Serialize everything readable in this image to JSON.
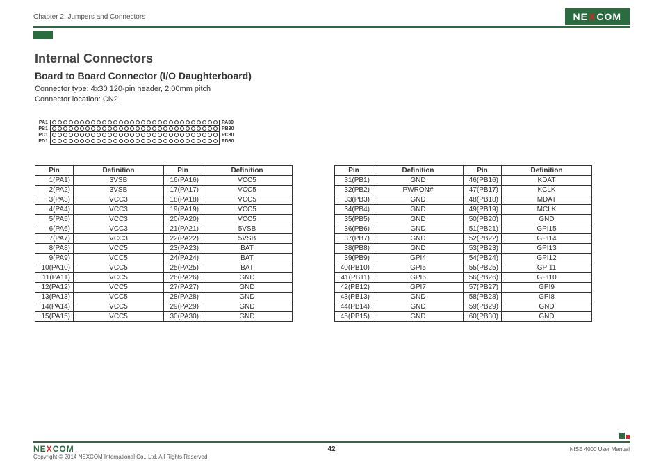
{
  "header": {
    "chapter": "Chapter 2: Jumpers and Connectors",
    "brand_pre": "NE",
    "brand_x": "X",
    "brand_post": "COM"
  },
  "title": "Internal Connectors",
  "subtitle": "Board to Board Connector (I/O Daughterboard)",
  "desc_line1": "Connector type: 4x30 120-pin header, 2.00mm pitch",
  "desc_line2": "Connector location: CN2",
  "diagram": {
    "rows": [
      {
        "left": "PA1",
        "right": "PA30"
      },
      {
        "left": "PB1",
        "right": "PB30"
      },
      {
        "left": "PC1",
        "right": "PC30"
      },
      {
        "left": "PD1",
        "right": "PD30"
      }
    ],
    "pins_per_row": 30
  },
  "table_headers": {
    "pin": "Pin",
    "def": "Definition"
  },
  "table1": [
    {
      "p1": "1(PA1)",
      "d1": "3VSB",
      "p2": "16(PA16)",
      "d2": "VCC5"
    },
    {
      "p1": "2(PA2)",
      "d1": "3VSB",
      "p2": "17(PA17)",
      "d2": "VCC5"
    },
    {
      "p1": "3(PA3)",
      "d1": "VCC3",
      "p2": "18(PA18)",
      "d2": "VCC5"
    },
    {
      "p1": "4(PA4)",
      "d1": "VCC3",
      "p2": "19(PA19)",
      "d2": "VCC5"
    },
    {
      "p1": "5(PA5)",
      "d1": "VCC3",
      "p2": "20(PA20)",
      "d2": "VCC5"
    },
    {
      "p1": "6(PA6)",
      "d1": "VCC3",
      "p2": "21(PA21)",
      "d2": "5VSB"
    },
    {
      "p1": "7(PA7)",
      "d1": "VCC3",
      "p2": "22(PA22)",
      "d2": "5VSB"
    },
    {
      "p1": "8(PA8)",
      "d1": "VCC5",
      "p2": "23(PA23)",
      "d2": "BAT"
    },
    {
      "p1": "9(PA9)",
      "d1": "VCC5",
      "p2": "24(PA24)",
      "d2": "BAT"
    },
    {
      "p1": "10(PA10)",
      "d1": "VCC5",
      "p2": "25(PA25)",
      "d2": "BAT"
    },
    {
      "p1": "11(PA11)",
      "d1": "VCC5",
      "p2": "26(PA26)",
      "d2": "GND"
    },
    {
      "p1": "12(PA12)",
      "d1": "VCC5",
      "p2": "27(PA27)",
      "d2": "GND"
    },
    {
      "p1": "13(PA13)",
      "d1": "VCC5",
      "p2": "28(PA28)",
      "d2": "GND"
    },
    {
      "p1": "14(PA14)",
      "d1": "VCC5",
      "p2": "29(PA29)",
      "d2": "GND"
    },
    {
      "p1": "15(PA15)",
      "d1": "VCC5",
      "p2": "30(PA30)",
      "d2": "GND"
    }
  ],
  "table2": [
    {
      "p1": "31(PB1)",
      "d1": "GND",
      "p2": "46(PB16)",
      "d2": "KDAT"
    },
    {
      "p1": "32(PB2)",
      "d1": "PWRON#",
      "p2": "47(PB17)",
      "d2": "KCLK"
    },
    {
      "p1": "33(PB3)",
      "d1": "GND",
      "p2": "48(PB18)",
      "d2": "MDAT"
    },
    {
      "p1": "34(PB4)",
      "d1": "GND",
      "p2": "49(PB19)",
      "d2": "MCLK"
    },
    {
      "p1": "35(PB5)",
      "d1": "GND",
      "p2": "50(PB20)",
      "d2": "GND"
    },
    {
      "p1": "36(PB6)",
      "d1": "GND",
      "p2": "51(PB21)",
      "d2": "GPI15"
    },
    {
      "p1": "37(PB7)",
      "d1": "GND",
      "p2": "52(PB22)",
      "d2": "GPI14"
    },
    {
      "p1": "38(PB8)",
      "d1": "GND",
      "p2": "53(PB23)",
      "d2": "GPI13"
    },
    {
      "p1": "39(PB9)",
      "d1": "GPI4",
      "p2": "54(PB24)",
      "d2": "GPI12"
    },
    {
      "p1": "40(PB10)",
      "d1": "GPI5",
      "p2": "55(PB25)",
      "d2": "GPI11"
    },
    {
      "p1": "41(PB11)",
      "d1": "GPI6",
      "p2": "56(PB26)",
      "d2": "GPI10"
    },
    {
      "p1": "42(PB12)",
      "d1": "GPI7",
      "p2": "57(PB27)",
      "d2": "GPI9"
    },
    {
      "p1": "43(PB13)",
      "d1": "GND",
      "p2": "58(PB28)",
      "d2": "GPI8"
    },
    {
      "p1": "44(PB14)",
      "d1": "GND",
      "p2": "59(PB29)",
      "d2": "GND"
    },
    {
      "p1": "45(PB15)",
      "d1": "GND",
      "p2": "60(PB30)",
      "d2": "GND"
    }
  ],
  "footer": {
    "copyright": "Copyright © 2014 NEXCOM International Co., Ltd. All Rights Reserved.",
    "page": "42",
    "manual": "NISE 4000 User Manual"
  }
}
